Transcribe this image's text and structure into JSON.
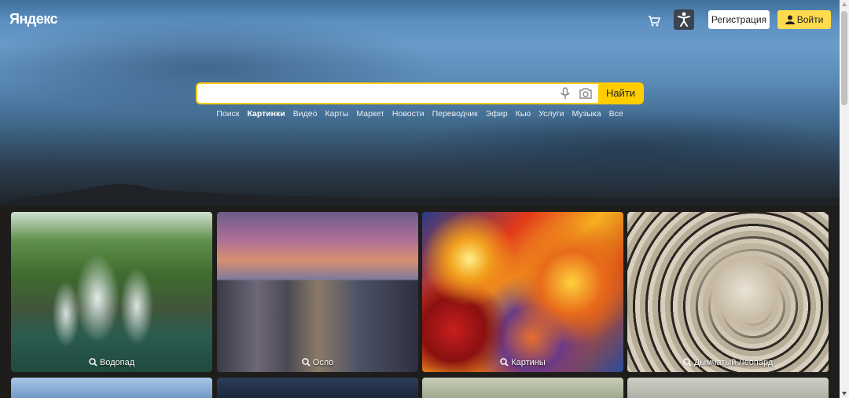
{
  "header": {
    "logo": "Яндекс",
    "register_label": "Регистрация",
    "login_label": "Войти"
  },
  "search": {
    "value": "",
    "placeholder": "",
    "button_label": "Найти"
  },
  "services": [
    {
      "label": "Поиск",
      "active": false
    },
    {
      "label": "Картинки",
      "active": true
    },
    {
      "label": "Видео",
      "active": false
    },
    {
      "label": "Карты",
      "active": false
    },
    {
      "label": "Маркет",
      "active": false
    },
    {
      "label": "Новости",
      "active": false
    },
    {
      "label": "Переводчик",
      "active": false
    },
    {
      "label": "Эфир",
      "active": false
    },
    {
      "label": "Кью",
      "active": false
    },
    {
      "label": "Услуги",
      "active": false
    },
    {
      "label": "Музыка",
      "active": false
    },
    {
      "label": "Все",
      "active": false
    }
  ],
  "tiles": [
    {
      "caption": "Водопад"
    },
    {
      "caption": "Осло"
    },
    {
      "caption": "Картины"
    },
    {
      "caption": "Дымчатый Леопард"
    }
  ],
  "colors": {
    "accent": "#ffdb4d",
    "search_border": "#ffcc00",
    "page_bg": "#1e1d1b"
  },
  "icons": [
    "cart-icon",
    "accessibility-icon",
    "user-icon",
    "mic-icon",
    "camera-icon",
    "search-icon"
  ]
}
